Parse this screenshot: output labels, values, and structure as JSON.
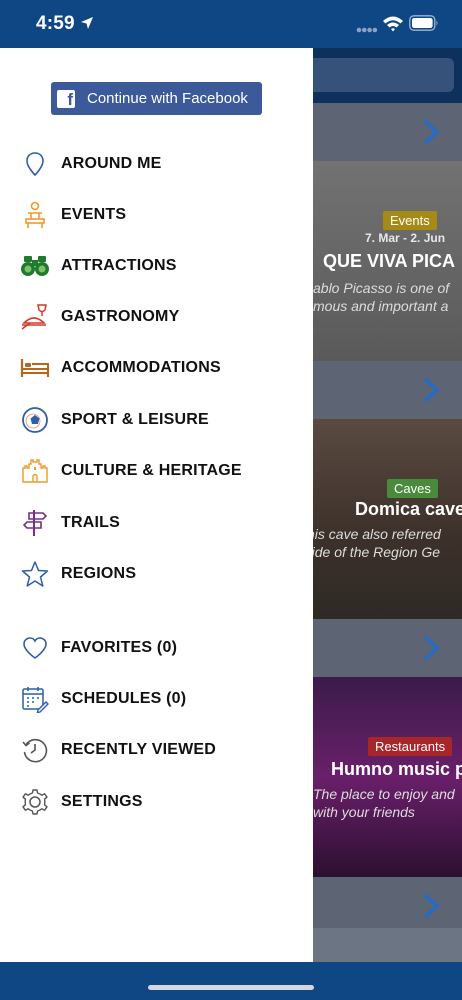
{
  "status_bar": {
    "time": "4:59"
  },
  "drawer": {
    "facebook_button": "Continue with Facebook",
    "menu": [
      {
        "label": "AROUND ME",
        "icon": "location-pin-icon"
      },
      {
        "label": "EVENTS",
        "icon": "events-icon"
      },
      {
        "label": "ATTRACTIONS",
        "icon": "binoculars-icon"
      },
      {
        "label": "GASTRONOMY",
        "icon": "gastronomy-icon"
      },
      {
        "label": "ACCOMMODATIONS",
        "icon": "bed-icon"
      },
      {
        "label": "SPORT & LEISURE",
        "icon": "soccer-ball-icon"
      },
      {
        "label": "CULTURE & HERITAGE",
        "icon": "castle-icon"
      },
      {
        "label": "TRAILS",
        "icon": "signpost-icon"
      },
      {
        "label": "REGIONS",
        "icon": "star-icon"
      },
      {
        "label": "FAVORITES (0)",
        "icon": "heart-icon"
      },
      {
        "label": "SCHEDULES (0)",
        "icon": "calendar-icon"
      },
      {
        "label": "RECENTLY VIEWED",
        "icon": "history-icon"
      },
      {
        "label": "SETTINGS",
        "icon": "gear-icon"
      }
    ]
  },
  "background": {
    "cards": [
      {
        "tag": "Events",
        "date": "7. Mar - 2. Jun",
        "title": "QUE VIVA PICA",
        "subtitle": "ablo Picasso is one of\nmous and important a"
      },
      {
        "tag": "Caves",
        "title": "Domica cave",
        "subtitle": "his cave also referred\nride of the Region Ge"
      },
      {
        "tag": "Restaurants",
        "title": "Humno music p",
        "subtitle": "The place to enjoy and\nwith your friends"
      }
    ]
  },
  "colors": {
    "brand_blue": "#0f4684",
    "facebook_blue": "#3c5a99",
    "icon_blue": "#2d5ea8",
    "icon_orange": "#f09a2a",
    "icon_green": "#1f7a2e",
    "icon_red": "#d23a2a",
    "icon_brown": "#b8651e",
    "icon_purple": "#7a2d8c"
  }
}
